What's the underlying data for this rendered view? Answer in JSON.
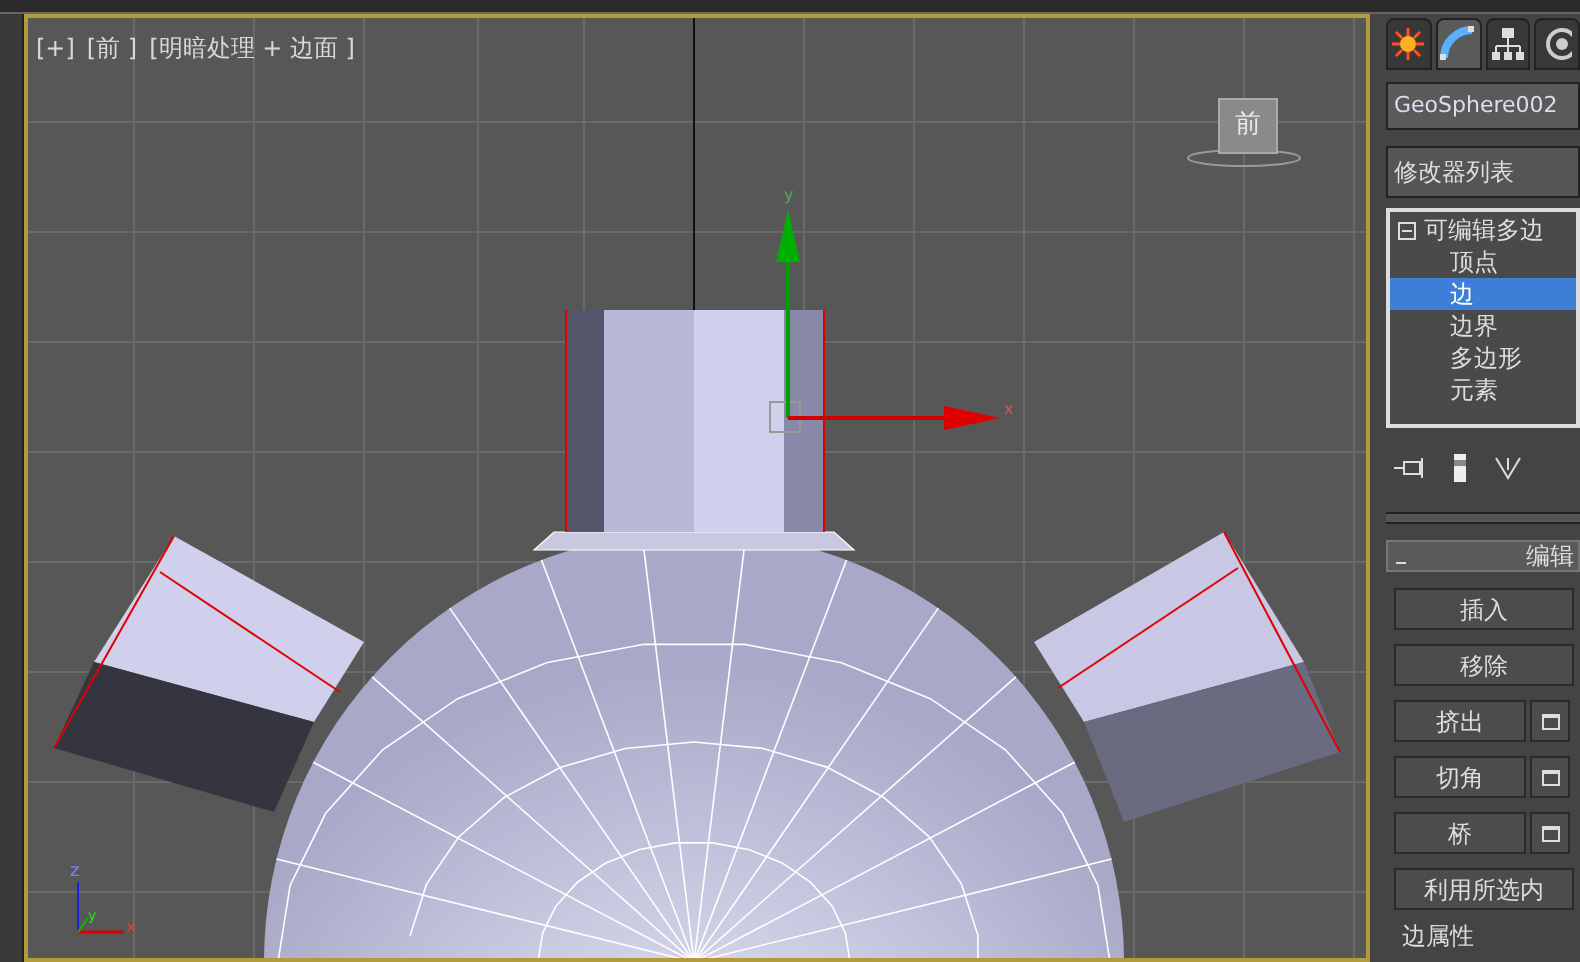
{
  "viewport": {
    "labels": [
      "[+]",
      "[前 ]",
      "[明暗处理 + 边面 ]"
    ],
    "viewcube_face": "前",
    "gizmo": {
      "y_label": "y",
      "x_label": "x"
    },
    "axis_tripod": {
      "z_label": "z",
      "y_label": "y",
      "x_label": "x"
    }
  },
  "command_panel": {
    "tabs": [
      {
        "kind": "create",
        "selected": false
      },
      {
        "kind": "modify",
        "selected": true
      },
      {
        "kind": "hierarchy",
        "selected": false
      },
      {
        "kind": "motion",
        "selected": false
      }
    ],
    "object_name": "GeoSphere002",
    "modifier_list": "修改器列表",
    "stack": {
      "label": "可编辑多边",
      "expanded": true,
      "children": [
        {
          "label": "顶点",
          "selected": false
        },
        {
          "label": "边",
          "selected": true
        },
        {
          "label": "边界",
          "selected": false
        },
        {
          "label": "多边形",
          "selected": false
        },
        {
          "label": "元素",
          "selected": false
        }
      ]
    },
    "rollout": {
      "title": "编辑",
      "expanded": true,
      "buttons": [
        {
          "label": "插入",
          "settings": false
        },
        {
          "label": "移除",
          "settings": false
        },
        {
          "label": "挤出",
          "settings": true
        },
        {
          "label": "切角",
          "settings": true
        },
        {
          "label": "桥",
          "settings": true
        },
        {
          "label": "利用所选内",
          "settings": false
        }
      ],
      "group_title": "边属性"
    }
  }
}
